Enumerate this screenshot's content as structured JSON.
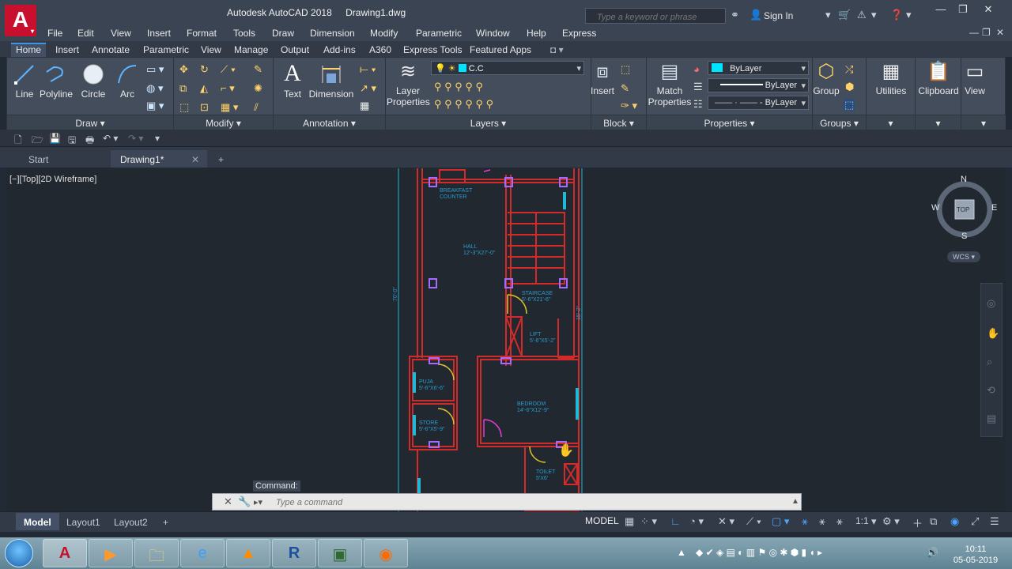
{
  "window": {
    "app_title": "Autodesk AutoCAD 2018",
    "file_title": "Drawing1.dwg",
    "logo_letter": "A",
    "search_placeholder": "Type a keyword or phrase",
    "sign_in": "Sign In"
  },
  "menu": [
    "File",
    "Edit",
    "View",
    "Insert",
    "Format",
    "Tools",
    "Draw",
    "Dimension",
    "Modify",
    "Parametric",
    "Window",
    "Help",
    "Express"
  ],
  "ribbon_tabs": [
    "Home",
    "Insert",
    "Annotate",
    "Parametric",
    "View",
    "Manage",
    "Output",
    "Add-ins",
    "A360",
    "Express Tools",
    "Featured Apps"
  ],
  "ribbon": {
    "draw_tools": [
      "Line",
      "Polyline",
      "Circle",
      "Arc"
    ],
    "text": "Text",
    "dimension": "Dimension",
    "layer_properties": "Layer Properties",
    "layer_current": "C.C",
    "insert": "Insert",
    "match_properties": "Match Properties",
    "color": "ByLayer",
    "lineweight": "ByLayer",
    "linetype": "- ByLayer",
    "group": "Group",
    "utilities": "Utilities",
    "clipboard": "Clipboard",
    "view": "View",
    "panels": [
      "Draw",
      "Modify",
      "Annotation",
      "Layers",
      "Block",
      "Properties",
      "Groups"
    ]
  },
  "file_tabs": [
    "Start",
    "Drawing1*"
  ],
  "viewport": {
    "label": "[−][Top][2D Wireframe]",
    "viewcube": {
      "n": "N",
      "s": "S",
      "e": "E",
      "w": "W",
      "face": "TOP"
    },
    "wcs": "WCS"
  },
  "rooms": [
    {
      "name": "BREAKFAST",
      "sub": "COUNTER"
    },
    {
      "name": "HALL",
      "sub": "12'-3\"X27'-0\""
    },
    {
      "name": "STAIRCASE",
      "sub": "5'-6\"X21'-6\""
    },
    {
      "name": "LIFT",
      "sub": "5'-6\"X5'-2\""
    },
    {
      "name": "PUJA",
      "sub": "5'-6\"X6'-6\""
    },
    {
      "name": "STORE",
      "sub": "5'-6\"X5'-9\""
    },
    {
      "name": "BEDROOM",
      "sub": "14'-6\"X12'-9\""
    },
    {
      "name": "TOILET",
      "sub": "5'X6'"
    }
  ],
  "dims": {
    "left": "70'-0\"",
    "right": "15'-2\""
  },
  "command": {
    "history": "Command:",
    "placeholder": "Type a command"
  },
  "layout_tabs": [
    "Model",
    "Layout1",
    "Layout2"
  ],
  "status": {
    "model": "MODEL",
    "scale": "1:1"
  },
  "clock": {
    "time": "10:11",
    "date": "05-05-2019"
  }
}
